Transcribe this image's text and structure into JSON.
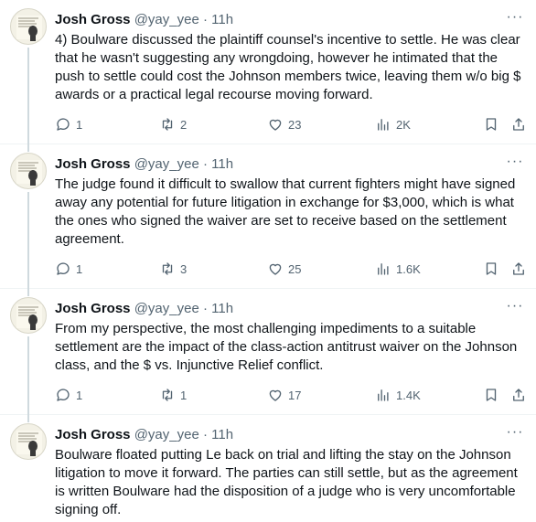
{
  "tweets": [
    {
      "author": "Josh Gross",
      "handle": "@yay_yee",
      "dot": "·",
      "time": "11h",
      "text": "4) Boulware discussed the plaintiff counsel's incentive to settle. He was clear that he wasn't suggesting any wrongdoing, however he intimated that the push to settle could cost the Johnson members twice, leaving them w/o big $ awards or a practical legal recourse moving forward.",
      "replies": "1",
      "reposts": "2",
      "likes": "23",
      "views": "2K"
    },
    {
      "author": "Josh Gross",
      "handle": "@yay_yee",
      "dot": "·",
      "time": "11h",
      "text": "The judge found it difficult to swallow that current fighters might have signed away any potential for future litigation in exchange for $3,000, which is what the ones who signed the waiver are set to receive based on the settlement agreement.",
      "replies": "1",
      "reposts": "3",
      "likes": "25",
      "views": "1.6K"
    },
    {
      "author": "Josh Gross",
      "handle": "@yay_yee",
      "dot": "·",
      "time": "11h",
      "text": "From my perspective, the most challenging impediments to a suitable settlement are the impact of the class-action antitrust waiver on the Johnson class, and the $ vs. Injunctive Relief conflict.",
      "replies": "1",
      "reposts": "1",
      "likes": "17",
      "views": "1.4K"
    },
    {
      "author": "Josh Gross",
      "handle": "@yay_yee",
      "dot": "·",
      "time": "11h",
      "text": "Boulware floated putting Le back on trial and lifting the stay on the Johnson litigation to move it forward. The parties can still settle, but as the agreement is written Boulware had the disposition of a judge who is very uncomfortable signing off."
    }
  ],
  "more_glyph": "···",
  "icons": [
    "reply-icon",
    "repost-icon",
    "like-icon",
    "views-icon",
    "bookmark-icon",
    "share-icon"
  ]
}
